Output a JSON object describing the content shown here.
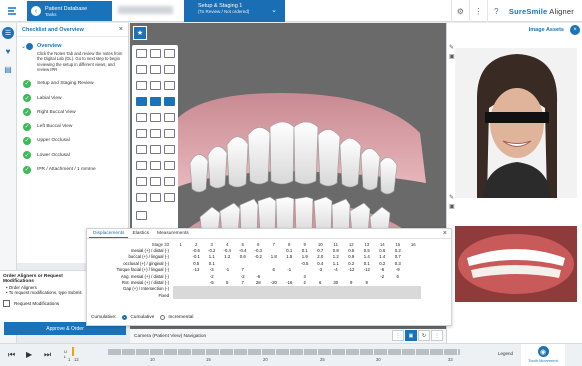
{
  "topbar": {
    "patient_title": "Patient Database",
    "patient_sub": "Tasks",
    "stage_title": "Setup & Staging 1",
    "stage_sub": "(To Review / Not ordered)",
    "brand_prefix": "SureSmile",
    "brand_suffix": "Aligner"
  },
  "checklist": {
    "title": "Checklist and Overview",
    "overview_title": "Overview",
    "overview_desc": "Click the Notes Tab and review the notes from the Digital Lab (DL). Go to next step to begin reviewing the setup in different views, and review IPR",
    "section": "Setup and Staging Review",
    "items": [
      {
        "label": "Labial View"
      },
      {
        "label": "Right Buccal View"
      },
      {
        "label": "Left Buccal View"
      },
      {
        "label": "Upper Occlusal"
      },
      {
        "label": "Lower Occlusal"
      },
      {
        "label": "IPR / Attachment / 1 mmIne"
      }
    ]
  },
  "order": {
    "heading": "Order Aligners or Request Modifications",
    "bullets": [
      "Order Aligners",
      "To request modifications, type Submit"
    ],
    "checkbox": "Request Modifications",
    "approve": "Approve & Order"
  },
  "viewport": {
    "camera_label": "Camera (Patient View) Navigation"
  },
  "assets": {
    "title": "Image Assets"
  },
  "table": {
    "tabs": [
      "Displacements",
      "Elastics",
      "Measurements"
    ],
    "stage_label": "Stage 33",
    "columns": [
      "1",
      "2",
      "3",
      "4",
      "5",
      "6",
      "7",
      "8",
      "9",
      "10",
      "11",
      "12",
      "13",
      "14",
      "15",
      "16"
    ],
    "rows": [
      {
        "label": "mesial (+) / distal (-)",
        "cells": [
          "",
          "-0.6",
          "-0.2",
          "-0.4",
          "-0.4",
          "-0.3",
          "",
          "0.1",
          "0.1",
          "0.7",
          "0.8",
          "0.5",
          "0.5",
          "0.6",
          "0.2",
          ""
        ]
      },
      {
        "label": "buccal (+) / lingual (-)",
        "cells": [
          "",
          "-0.1",
          "1.1",
          "1.2",
          "0.6",
          "-0.2",
          "1.8",
          "1.5",
          "1.9",
          "2.0",
          "1.2",
          "0.9",
          "1.4",
          "1.4",
          "0.7",
          ""
        ]
      },
      {
        "label": "occlusal (+) / gingival (-)",
        "cells": [
          "",
          "0.5",
          "0.1",
          "",
          "",
          "",
          "",
          "",
          "-0.5",
          "0.4",
          "1.1",
          "0.2",
          "0.1",
          "0.2",
          "0.3",
          ""
        ]
      },
      {
        "label": "Torque facial (+) / lingual (-)",
        "cells": [
          "",
          "-13",
          "-3",
          "-1",
          "7",
          "",
          "6",
          "-1",
          "",
          "-3",
          "-4",
          "-12",
          "-12",
          "-6",
          "-9",
          ""
        ]
      },
      {
        "label": "Ang. mesial (+) / distal (-)",
        "cells": [
          "",
          "",
          "-2",
          "",
          "-2",
          "-6",
          "",
          "",
          "3",
          "",
          "",
          "",
          "",
          "-2",
          "6",
          ""
        ]
      },
      {
        "label": "Rot. mesial (+) / distal (-)",
        "cells": [
          "",
          "",
          "-5",
          "5",
          "7",
          "28",
          "-20",
          "-16",
          "2",
          "6",
          "30",
          "9",
          "9",
          "",
          "",
          ""
        ]
      },
      {
        "label": "Gap (+) / Intersection (-)",
        "cells": [
          "",
          "",
          "",
          "",
          "",
          "",
          "",
          "",
          "",
          "",
          "",
          "",
          "",
          "",
          "",
          ""
        ]
      },
      {
        "label": "Fixed",
        "cells": [
          "",
          "",
          "",
          "",
          "",
          "",
          "",
          "",
          "",
          "",
          "",
          "",
          "",
          "",
          "",
          ""
        ]
      }
    ],
    "cumulative_label": "Cumulative:",
    "opt_cumulative": "Cumulative",
    "opt_incremental": "Incremental"
  },
  "timeline": {
    "upper": "U",
    "lower": "L",
    "stage_start": "1",
    "stage_current": "12",
    "ticks": [
      "10",
      "15",
      "20",
      "25",
      "30",
      "33"
    ],
    "legend": "Legend",
    "tooth_button": "Tooth Movement"
  }
}
